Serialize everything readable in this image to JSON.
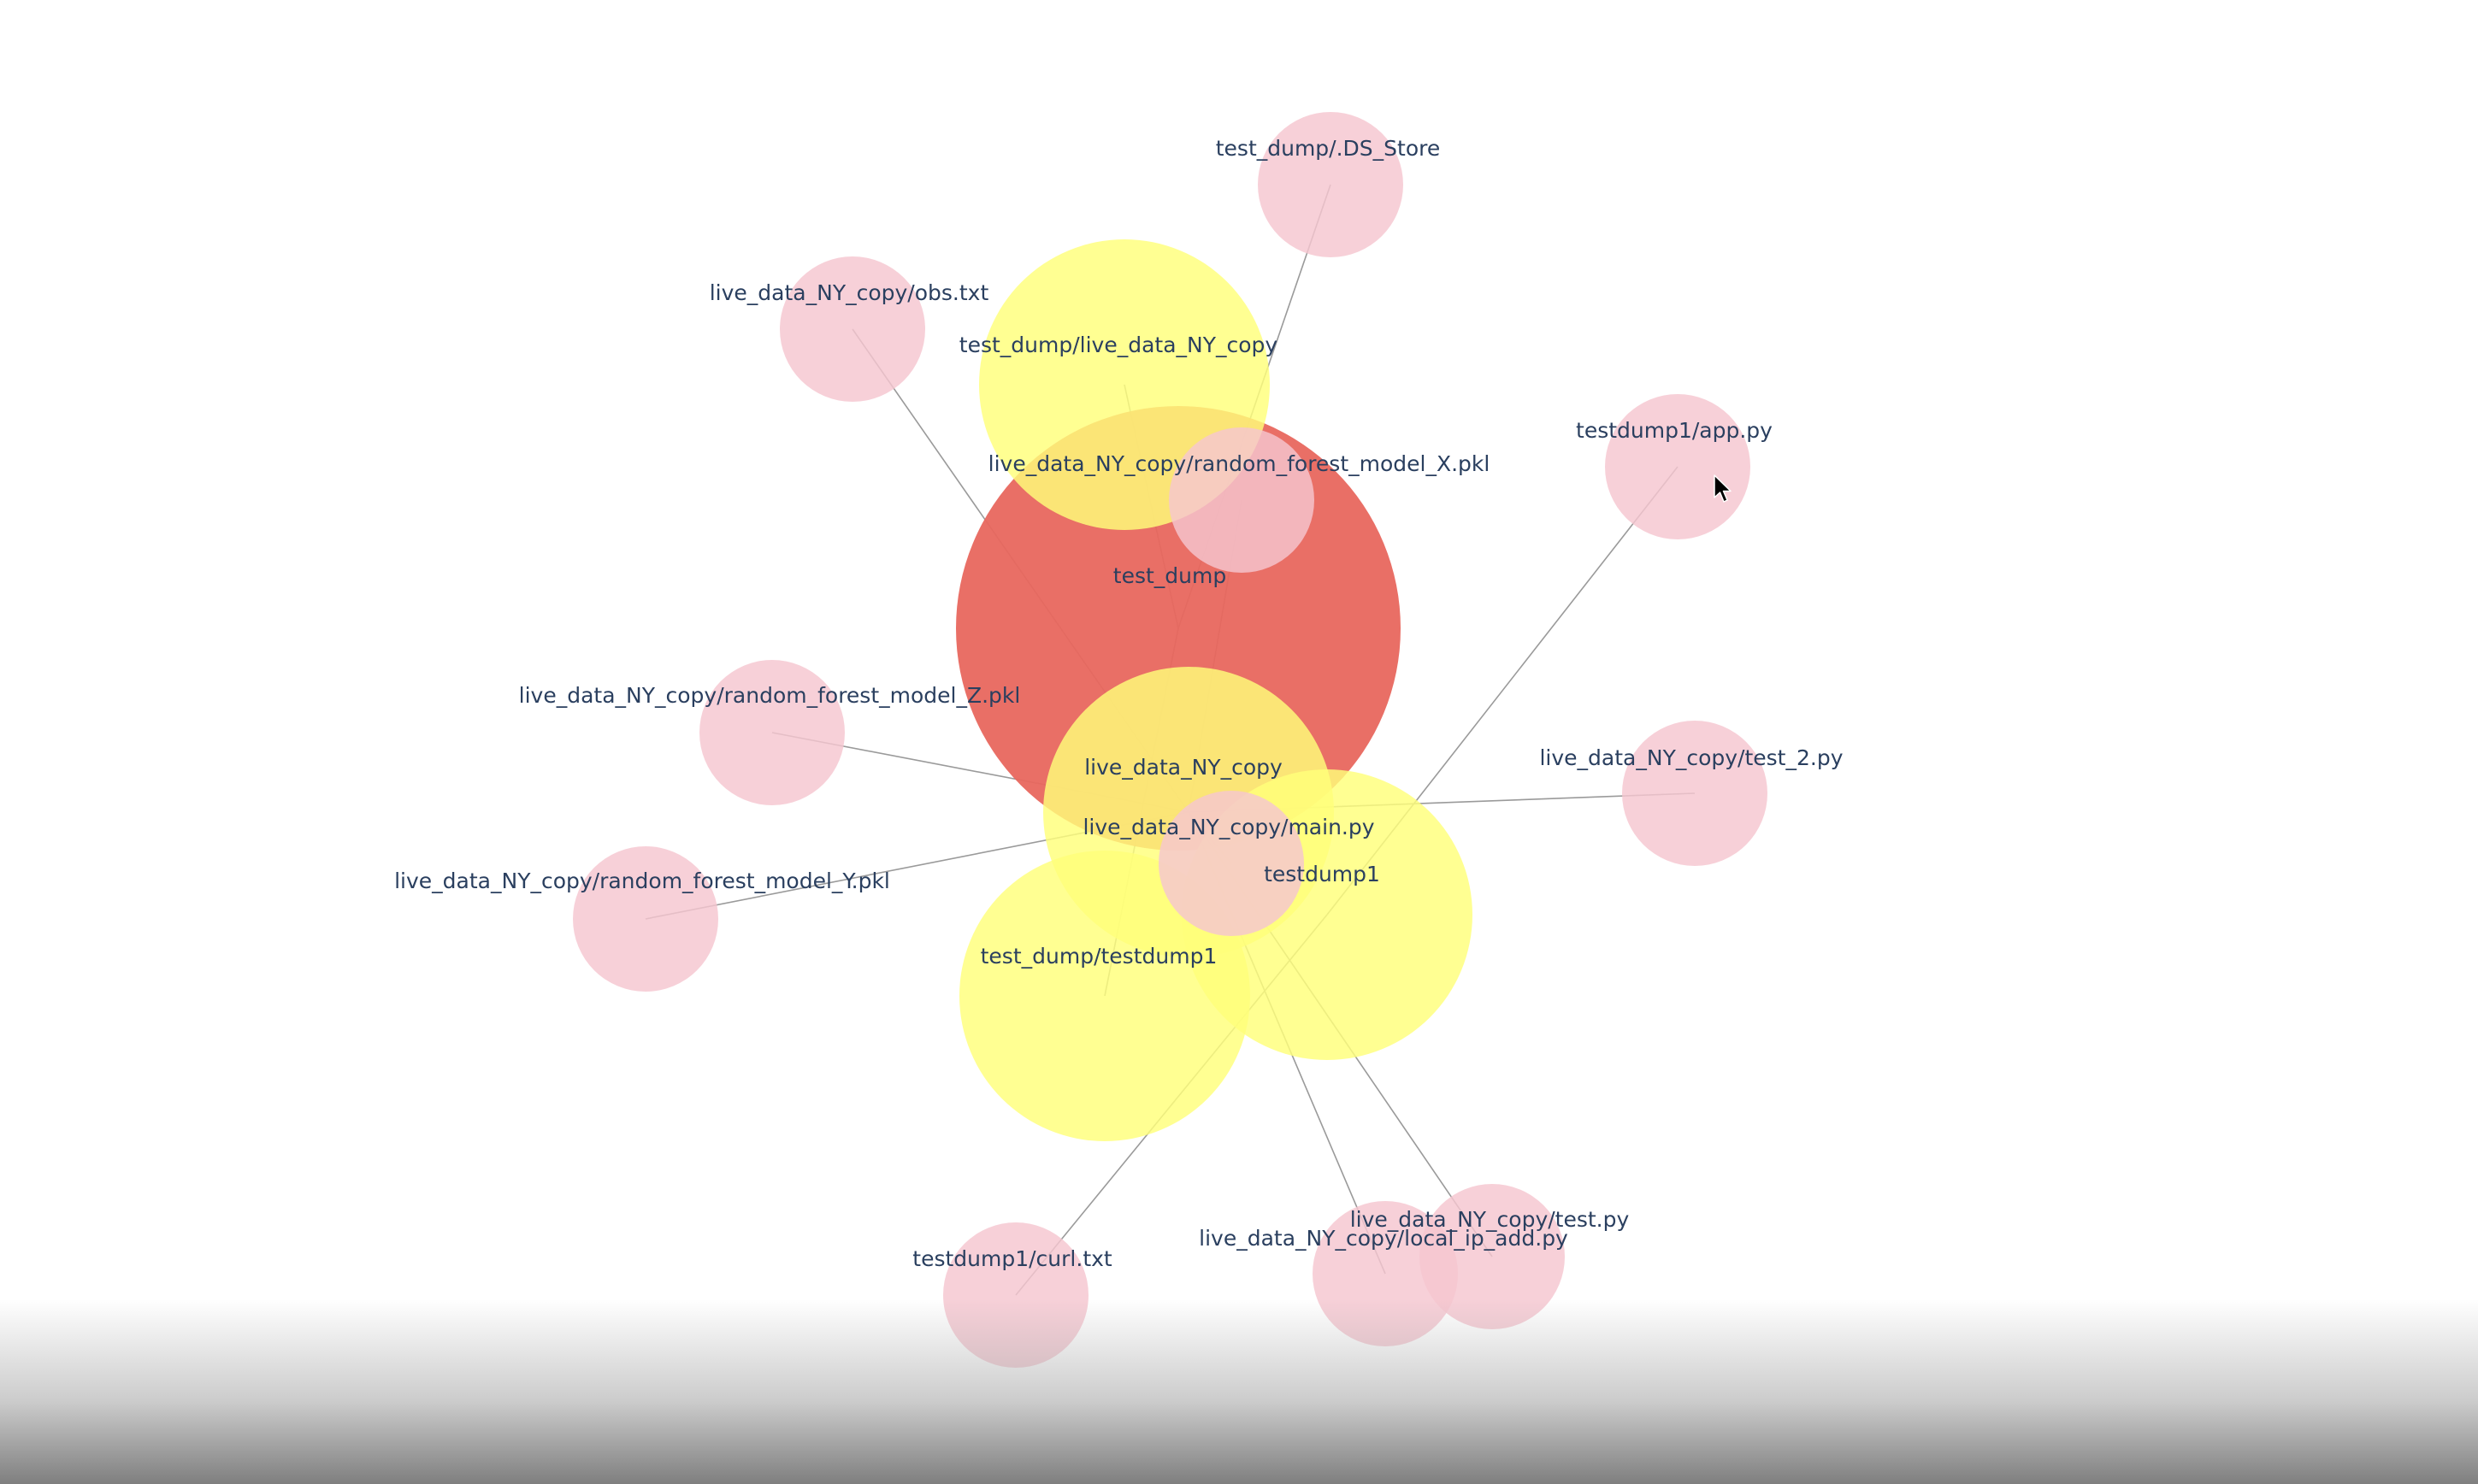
{
  "colors": {
    "root": "#e8675e",
    "folder": "#ffff7a",
    "file": "#f5c6cf",
    "edge": "#9a9a9a",
    "label": "#2a3f5f"
  },
  "graph": {
    "nodes": [
      {
        "id": "test_dump",
        "label": "test_dump",
        "kind": "root"
      },
      {
        "id": "f1",
        "label": "test_dump/live_data_NY_copy",
        "kind": "folder"
      },
      {
        "id": "f2",
        "label": "live_data_NY_copy",
        "kind": "folder"
      },
      {
        "id": "f3",
        "label": "test_dump/testdump1",
        "kind": "folder"
      },
      {
        "id": "f4",
        "label": "testdump1",
        "kind": "folder"
      },
      {
        "id": "n1",
        "label": "test_dump/.DS_Store",
        "kind": "file"
      },
      {
        "id": "n2",
        "label": "live_data_NY_copy/obs.txt",
        "kind": "file"
      },
      {
        "id": "n3",
        "label": "live_data_NY_copy/random_forest_model_X.pkl",
        "kind": "file"
      },
      {
        "id": "n4",
        "label": "testdump1/app.py",
        "kind": "file"
      },
      {
        "id": "n5",
        "label": "live_data_NY_copy/random_forest_model_Z.pkl",
        "kind": "file"
      },
      {
        "id": "n6",
        "label": "live_data_NY_copy/test_2.py",
        "kind": "file"
      },
      {
        "id": "n7",
        "label": "live_data_NY_copy/main.py",
        "kind": "file"
      },
      {
        "id": "n8",
        "label": "live_data_NY_copy/random_forest_model_Y.pkl",
        "kind": "file"
      },
      {
        "id": "n9",
        "label": "live_data_NY_copy/test.py",
        "kind": "file"
      },
      {
        "id": "n10",
        "label": "live_data_NY_copy/local_ip_add.py",
        "kind": "file"
      },
      {
        "id": "n11",
        "label": "testdump1/curl.txt",
        "kind": "file"
      }
    ],
    "edges": [
      [
        "n1",
        "test_dump"
      ],
      [
        "n2",
        "f2"
      ],
      [
        "n3",
        "f2"
      ],
      [
        "f1",
        "test_dump"
      ],
      [
        "f3",
        "test_dump"
      ],
      [
        "n4",
        "f4"
      ],
      [
        "n5",
        "f2"
      ],
      [
        "n6",
        "f2"
      ],
      [
        "n8",
        "f2"
      ],
      [
        "n7",
        "f2"
      ],
      [
        "n9",
        "f2"
      ],
      [
        "n10",
        "f2"
      ],
      [
        "n11",
        "f4"
      ]
    ]
  }
}
